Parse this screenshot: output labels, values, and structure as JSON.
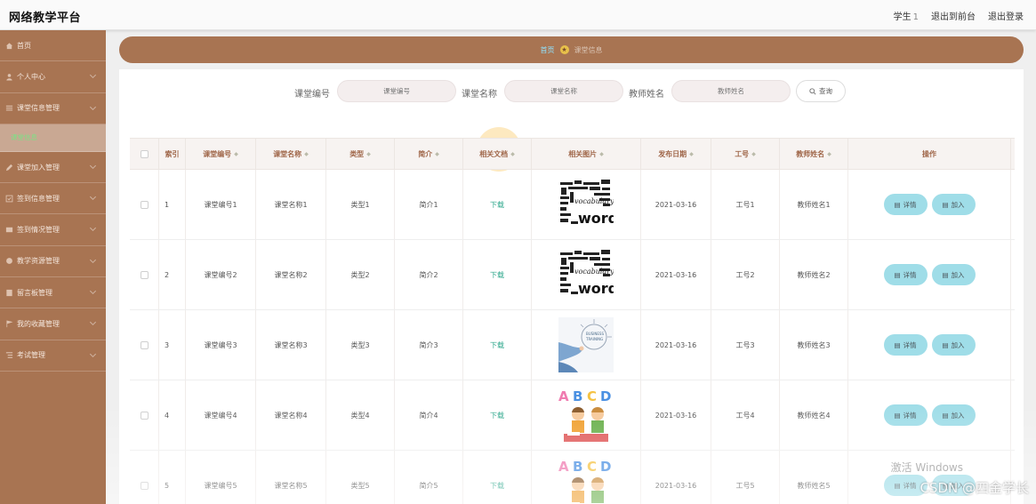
{
  "app": {
    "title": "网络教学平台"
  },
  "header": {
    "user_label": "学生",
    "user_num": "1",
    "back_label": "退出到前台",
    "logout_label": "退出登录"
  },
  "sidebar": {
    "items": [
      {
        "label": "首页",
        "icon": "home-icon",
        "expandable": false
      },
      {
        "label": "个人中心",
        "icon": "user-icon",
        "expandable": true
      },
      {
        "label": "课堂信息管理",
        "icon": "list-icon",
        "expandable": true
      },
      {
        "label": "课堂加入管理",
        "icon": "pen-icon",
        "expandable": true
      },
      {
        "label": "签到信息管理",
        "icon": "checkin-icon",
        "expandable": true
      },
      {
        "label": "签到情况管理",
        "icon": "message-icon",
        "expandable": true
      },
      {
        "label": "教学资源管理",
        "icon": "resource-icon",
        "expandable": true
      },
      {
        "label": "留言板管理",
        "icon": "board-icon",
        "expandable": true
      },
      {
        "label": "我的收藏管理",
        "icon": "flag-icon",
        "expandable": true
      },
      {
        "label": "考试管理",
        "icon": "exam-icon",
        "expandable": true
      }
    ],
    "sub_item": {
      "label": "课堂信息"
    }
  },
  "breadcrumb": {
    "home": "首页",
    "current": "课堂信息"
  },
  "search": {
    "code_label": "课堂编号",
    "code_placeholder": "课堂编号",
    "name_label": "课堂名称",
    "name_placeholder": "课堂名称",
    "teacher_label": "教师姓名",
    "teacher_placeholder": "教师姓名",
    "button_label": "查询"
  },
  "table": {
    "headers": [
      "索引",
      "课堂编号",
      "课堂名称",
      "类型",
      "简介",
      "相关文档",
      "相关图片",
      "发布日期",
      "工号",
      "教师姓名",
      "操作"
    ],
    "detail_label": "详情",
    "join_label": "加入",
    "rows": [
      {
        "index": "1",
        "code": "课堂编号1",
        "name": "课堂名称1",
        "type": "类型1",
        "intro": "简介1",
        "doc": "下载",
        "image": "word-cloud",
        "date": "2021-03-16",
        "staff_no": "工号1",
        "teacher": "教师姓名1"
      },
      {
        "index": "2",
        "code": "课堂编号2",
        "name": "课堂名称2",
        "type": "类型2",
        "intro": "简介2",
        "doc": "下载",
        "image": "word-cloud",
        "date": "2021-03-16",
        "staff_no": "工号2",
        "teacher": "教师姓名2"
      },
      {
        "index": "3",
        "code": "课堂编号3",
        "name": "课堂名称3",
        "type": "类型3",
        "intro": "简介3",
        "doc": "下载",
        "image": "business-diagram",
        "date": "2021-03-16",
        "staff_no": "工号3",
        "teacher": "教师姓名3"
      },
      {
        "index": "4",
        "code": "课堂编号4",
        "name": "课堂名称4",
        "type": "类型4",
        "intro": "简介4",
        "doc": "下载",
        "image": "abcd-kids",
        "date": "2021-03-16",
        "staff_no": "工号4",
        "teacher": "教师姓名4"
      },
      {
        "index": "5",
        "code": "课堂编号5",
        "name": "课堂名称5",
        "type": "类型5",
        "intro": "简介5",
        "doc": "下载",
        "image": "abcd-kids",
        "date": "2021-03-16",
        "staff_no": "工号5",
        "teacher": "教师姓名5"
      }
    ]
  },
  "watermark": {
    "windows": "激活 Windows",
    "csdn": "CSDN @四金学长"
  },
  "colors": {
    "sidebar": "#a87452",
    "breadcrumb_bg": "#a87452",
    "button": "#9fdde8",
    "download": "#2aa68a",
    "header_text": "#a0674a"
  }
}
